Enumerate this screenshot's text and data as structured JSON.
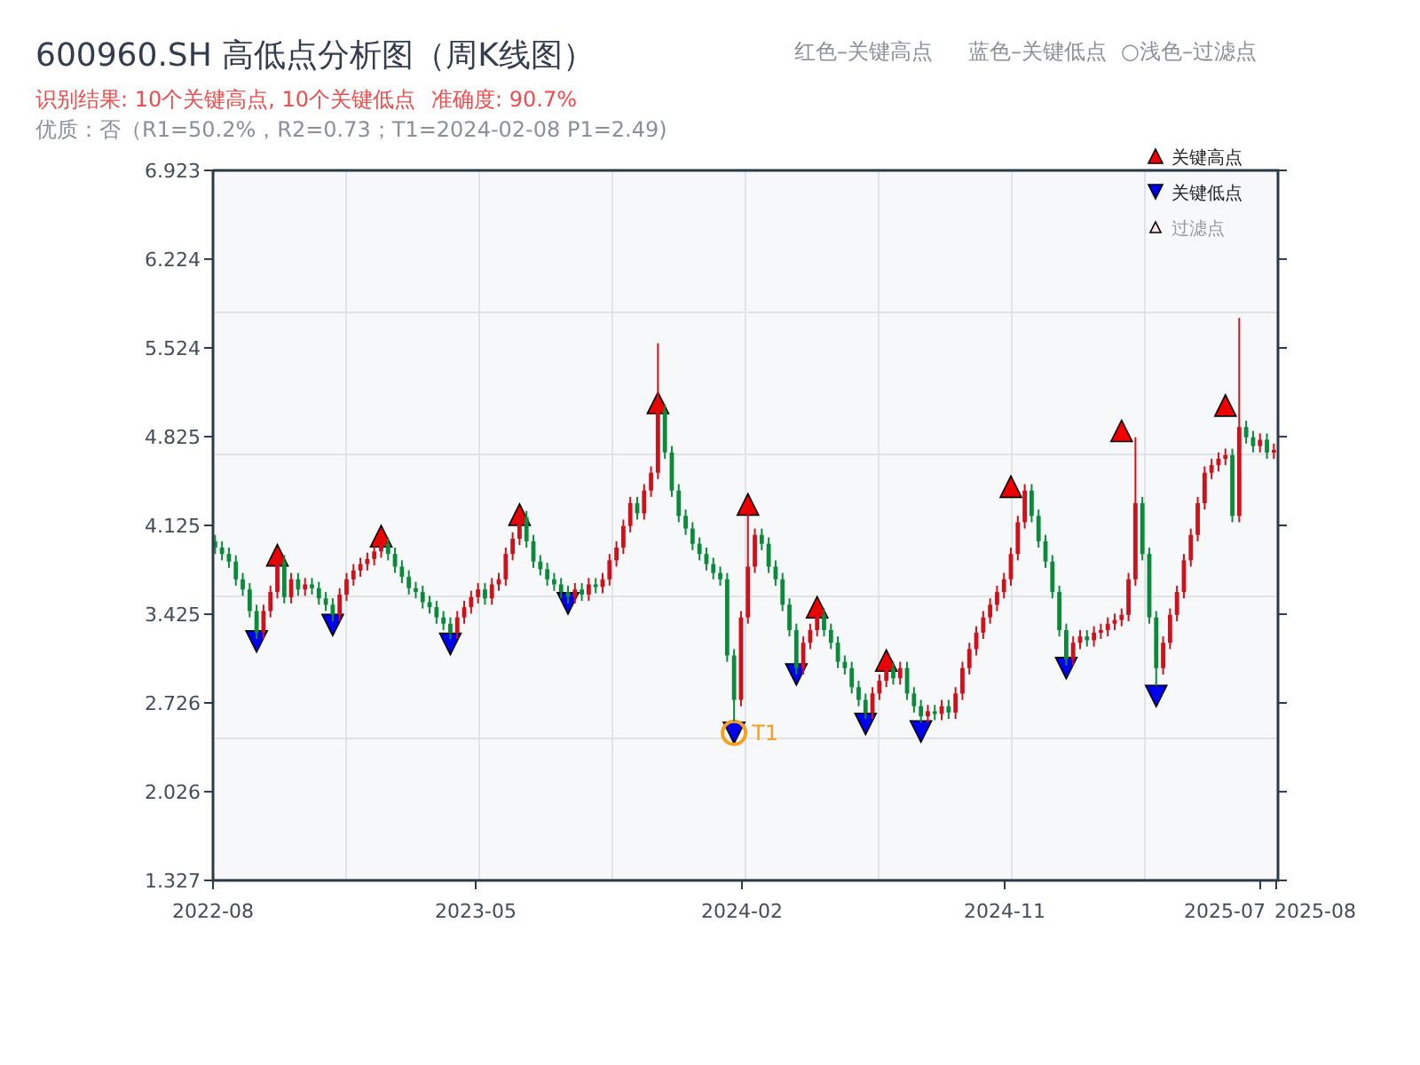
{
  "title": "600960.SH 高低点分析图（周K线图）",
  "top_legend": [
    {
      "kind": "high",
      "label": "红色–关键高点"
    },
    {
      "kind": "low",
      "label": "蓝色–关键低点"
    },
    {
      "kind": "filtered",
      "label": "○浅色–过滤点"
    }
  ],
  "result": {
    "summary": "识别结果: 10个关键高点, 10个关键低点",
    "accuracy": "准确度: 90.7%"
  },
  "quality": "优质：否（R1=50.2%，R2=0.73；T1=2024-02-08 P1=2.49)",
  "chart": {
    "legend": [
      {
        "kind": "high",
        "label": "关键高点"
      },
      {
        "kind": "low",
        "label": "关键低点"
      },
      {
        "kind": "filtered",
        "label": "过滤点"
      }
    ],
    "x_labels": [
      "2022-08",
      "2023-05",
      "2024-02",
      "2024-11",
      "2025-07",
      "2025-08"
    ],
    "chart_data": {
      "type": "candlestick",
      "ylim": [
        1.327,
        6.923
      ],
      "yticks": [
        {
          "value": 6.923,
          "label": "6.923"
        },
        {
          "value": 6.224,
          "label": "6.224"
        },
        {
          "value": 5.524,
          "label": "5.524"
        },
        {
          "value": 4.825,
          "label": "4.825"
        },
        {
          "value": 4.125,
          "label": "4.125"
        },
        {
          "value": 3.425,
          "label": "3.425"
        },
        {
          "value": 2.726,
          "label": "2.726"
        },
        {
          "value": 2.026,
          "label": "2.026"
        },
        {
          "value": 1.327,
          "label": "1.327"
        }
      ],
      "series": [
        {
          "type": "scatter",
          "color": "#f00000",
          "marker": "triangle-up",
          "values": [
            null,
            null,
            null,
            null,
            null,
            null,
            null,
            null,
            null,
            3.89,
            null,
            null,
            null,
            null,
            null,
            null,
            null,
            null,
            null,
            null,
            null,
            null,
            null,
            null,
            4.04,
            null,
            null,
            null,
            null,
            null,
            null,
            null,
            null,
            null,
            null,
            null,
            null,
            null,
            null,
            null,
            null,
            null,
            null,
            null,
            4.21,
            null,
            null,
            null,
            null,
            null,
            null,
            null,
            null,
            null,
            null,
            null,
            null,
            null,
            null,
            null,
            null,
            null,
            null,
            null,
            5.09,
            null,
            null,
            null,
            null,
            null,
            null,
            null,
            null,
            null,
            null,
            null,
            null,
            4.29,
            null,
            null,
            null,
            null,
            null,
            null,
            null,
            null,
            null,
            3.48,
            null,
            null,
            null,
            null,
            null,
            null,
            null,
            null,
            null,
            3.06,
            null,
            null,
            null,
            null,
            null,
            null,
            null,
            null,
            null,
            null,
            null,
            null,
            null,
            null,
            null,
            null,
            null,
            4.43,
            null,
            null,
            null,
            null,
            null,
            null,
            null,
            null,
            null,
            null,
            null,
            null,
            null,
            null,
            null,
            4.87,
            null,
            null,
            null,
            null,
            null,
            null,
            null,
            null,
            null,
            null,
            null,
            null,
            null,
            null,
            5.07,
            null,
            null,
            null,
            null,
            null
          ]
        },
        {
          "type": "scatter",
          "color": "#0000f0",
          "marker": "triangle-down",
          "values": [
            null,
            null,
            null,
            null,
            null,
            null,
            3.21,
            null,
            null,
            null,
            null,
            null,
            null,
            null,
            null,
            null,
            null,
            3.34,
            null,
            null,
            null,
            null,
            null,
            null,
            null,
            null,
            null,
            null,
            null,
            null,
            null,
            null,
            null,
            null,
            3.19,
            null,
            null,
            null,
            null,
            null,
            null,
            null,
            null,
            null,
            null,
            null,
            null,
            null,
            null,
            null,
            null,
            3.51,
            null,
            null,
            null,
            null,
            null,
            null,
            null,
            null,
            null,
            null,
            null,
            null,
            null,
            null,
            null,
            null,
            null,
            null,
            null,
            null,
            null,
            null,
            null,
            2.49,
            null,
            null,
            null,
            null,
            null,
            null,
            null,
            null,
            2.95,
            null,
            null,
            null,
            null,
            null,
            null,
            null,
            null,
            null,
            2.56,
            null,
            null,
            null,
            null,
            null,
            null,
            null,
            2.5,
            null,
            null,
            null,
            null,
            null,
            null,
            null,
            null,
            null,
            null,
            null,
            null,
            null,
            null,
            null,
            null,
            null,
            null,
            null,
            null,
            3.0,
            null,
            null,
            null,
            null,
            null,
            null,
            null,
            null,
            null,
            null,
            null,
            null,
            2.78,
            null,
            null,
            null,
            null,
            null,
            null,
            null,
            null,
            null,
            null,
            null,
            null,
            null,
            null,
            null,
            null,
            null
          ]
        }
      ],
      "annotations": [
        {
          "text": "T1"
        }
      ],
      "ohlc": [
        [
          4.0,
          4.05,
          3.9,
          3.95
        ],
        [
          3.95,
          4.0,
          3.85,
          3.9
        ],
        [
          3.9,
          3.95,
          3.79,
          3.84
        ],
        [
          3.84,
          3.89,
          3.65,
          3.7
        ],
        [
          3.7,
          3.75,
          3.57,
          3.62
        ],
        [
          3.62,
          3.67,
          3.4,
          3.45
        ],
        [
          3.45,
          3.5,
          3.23,
          3.28
        ],
        [
          3.28,
          3.5,
          3.23,
          3.45
        ],
        [
          3.45,
          3.65,
          3.4,
          3.6
        ],
        [
          3.6,
          3.89,
          3.55,
          3.84
        ],
        [
          3.84,
          3.89,
          3.51,
          3.56
        ],
        [
          3.56,
          3.75,
          3.51,
          3.7
        ],
        [
          3.7,
          3.75,
          3.57,
          3.62
        ],
        [
          3.62,
          3.71,
          3.57,
          3.66
        ],
        [
          3.66,
          3.71,
          3.58,
          3.63
        ],
        [
          3.63,
          3.68,
          3.5,
          3.55
        ],
        [
          3.55,
          3.6,
          3.45,
          3.5
        ],
        [
          3.5,
          3.55,
          3.37,
          3.42
        ],
        [
          3.42,
          3.63,
          3.37,
          3.58
        ],
        [
          3.58,
          3.75,
          3.53,
          3.7
        ],
        [
          3.7,
          3.82,
          3.65,
          3.77
        ],
        [
          3.77,
          3.87,
          3.72,
          3.82
        ],
        [
          3.82,
          3.91,
          3.77,
          3.86
        ],
        [
          3.86,
          3.97,
          3.81,
          3.92
        ],
        [
          3.92,
          4.03,
          3.87,
          3.98
        ],
        [
          3.98,
          4.03,
          3.85,
          3.9
        ],
        [
          3.9,
          3.95,
          3.75,
          3.8
        ],
        [
          3.8,
          3.85,
          3.67,
          3.72
        ],
        [
          3.72,
          3.77,
          3.58,
          3.63
        ],
        [
          3.63,
          3.68,
          3.55,
          3.6
        ],
        [
          3.6,
          3.65,
          3.47,
          3.52
        ],
        [
          3.52,
          3.57,
          3.43,
          3.48
        ],
        [
          3.48,
          3.53,
          3.35,
          3.4
        ],
        [
          3.4,
          3.45,
          3.3,
          3.35
        ],
        [
          3.35,
          3.4,
          3.23,
          3.28
        ],
        [
          3.28,
          3.45,
          3.23,
          3.4
        ],
        [
          3.4,
          3.53,
          3.35,
          3.48
        ],
        [
          3.48,
          3.61,
          3.43,
          3.56
        ],
        [
          3.56,
          3.67,
          3.51,
          3.62
        ],
        [
          3.62,
          3.67,
          3.5,
          3.55
        ],
        [
          3.55,
          3.71,
          3.5,
          3.66
        ],
        [
          3.66,
          3.75,
          3.61,
          3.7
        ],
        [
          3.7,
          3.95,
          3.65,
          3.9
        ],
        [
          3.9,
          4.07,
          3.85,
          4.02
        ],
        [
          4.02,
          4.24,
          3.97,
          4.19
        ],
        [
          4.19,
          4.24,
          3.95,
          4.0
        ],
        [
          4.0,
          4.05,
          3.79,
          3.84
        ],
        [
          3.84,
          3.89,
          3.73,
          3.78
        ],
        [
          3.78,
          3.83,
          3.65,
          3.7
        ],
        [
          3.7,
          3.75,
          3.61,
          3.66
        ],
        [
          3.66,
          3.71,
          3.55,
          3.6
        ],
        [
          3.6,
          3.65,
          3.51,
          3.56
        ],
        [
          3.56,
          3.67,
          3.51,
          3.62
        ],
        [
          3.62,
          3.67,
          3.53,
          3.58
        ],
        [
          3.58,
          3.71,
          3.53,
          3.66
        ],
        [
          3.66,
          3.71,
          3.59,
          3.64
        ],
        [
          3.64,
          3.75,
          3.59,
          3.7
        ],
        [
          3.7,
          3.9,
          3.65,
          3.85
        ],
        [
          3.85,
          4.0,
          3.8,
          3.95
        ],
        [
          3.95,
          4.17,
          3.9,
          4.12
        ],
        [
          4.12,
          4.35,
          4.07,
          4.3
        ],
        [
          4.3,
          4.35,
          4.17,
          4.22
        ],
        [
          4.22,
          4.45,
          4.17,
          4.4
        ],
        [
          4.4,
          4.59,
          4.35,
          4.54
        ],
        [
          4.54,
          5.56,
          4.49,
          5.03
        ],
        [
          5.03,
          5.08,
          4.65,
          4.7
        ],
        [
          4.7,
          4.75,
          4.35,
          4.4
        ],
        [
          4.4,
          4.45,
          4.15,
          4.2
        ],
        [
          4.2,
          4.25,
          4.05,
          4.1
        ],
        [
          4.1,
          4.15,
          3.93,
          3.98
        ],
        [
          3.98,
          4.03,
          3.85,
          3.9
        ],
        [
          3.9,
          3.95,
          3.77,
          3.82
        ],
        [
          3.82,
          3.87,
          3.7,
          3.75
        ],
        [
          3.75,
          3.8,
          3.65,
          3.7
        ],
        [
          3.7,
          3.75,
          3.05,
          3.1
        ],
        [
          3.1,
          3.15,
          2.58,
          2.75
        ],
        [
          2.75,
          3.45,
          2.7,
          3.4
        ],
        [
          3.4,
          4.26,
          3.35,
          3.8
        ],
        [
          3.8,
          4.1,
          3.75,
          4.05
        ],
        [
          4.05,
          4.1,
          3.93,
          3.98
        ],
        [
          3.98,
          4.03,
          3.75,
          3.8
        ],
        [
          3.8,
          3.85,
          3.65,
          3.7
        ],
        [
          3.7,
          3.75,
          3.45,
          3.5
        ],
        [
          3.5,
          3.55,
          3.25,
          3.3
        ],
        [
          3.3,
          3.35,
          2.95,
          3.0
        ],
        [
          3.0,
          3.25,
          2.95,
          3.2
        ],
        [
          3.2,
          3.35,
          3.15,
          3.3
        ],
        [
          3.3,
          3.47,
          3.25,
          3.42
        ],
        [
          3.42,
          3.47,
          3.25,
          3.3
        ],
        [
          3.3,
          3.35,
          3.15,
          3.2
        ],
        [
          3.2,
          3.25,
          3.0,
          3.05
        ],
        [
          3.05,
          3.1,
          2.95,
          3.0
        ],
        [
          3.0,
          3.05,
          2.8,
          2.85
        ],
        [
          2.85,
          2.9,
          2.7,
          2.75
        ],
        [
          2.75,
          2.8,
          2.6,
          2.65
        ],
        [
          2.65,
          2.85,
          2.6,
          2.8
        ],
        [
          2.8,
          2.95,
          2.75,
          2.9
        ],
        [
          2.9,
          3.05,
          2.85,
          3.0
        ],
        [
          3.0,
          3.05,
          2.87,
          2.92
        ],
        [
          2.92,
          3.05,
          2.87,
          3.0
        ],
        [
          3.0,
          3.05,
          2.75,
          2.8
        ],
        [
          2.8,
          2.85,
          2.65,
          2.7
        ],
        [
          2.7,
          2.75,
          2.57,
          2.62
        ],
        [
          2.62,
          2.71,
          2.57,
          2.66
        ],
        [
          2.66,
          2.71,
          2.59,
          2.64
        ],
        [
          2.64,
          2.75,
          2.59,
          2.7
        ],
        [
          2.7,
          2.75,
          2.6,
          2.65
        ],
        [
          2.65,
          2.85,
          2.6,
          2.8
        ],
        [
          2.8,
          3.05,
          2.75,
          3.0
        ],
        [
          3.0,
          3.2,
          2.95,
          3.15
        ],
        [
          3.15,
          3.33,
          3.1,
          3.28
        ],
        [
          3.28,
          3.45,
          3.23,
          3.4
        ],
        [
          3.4,
          3.55,
          3.35,
          3.5
        ],
        [
          3.5,
          3.65,
          3.45,
          3.6
        ],
        [
          3.6,
          3.75,
          3.55,
          3.7
        ],
        [
          3.7,
          3.95,
          3.65,
          3.9
        ],
        [
          3.9,
          4.2,
          3.85,
          4.15
        ],
        [
          4.15,
          4.45,
          4.1,
          4.4
        ],
        [
          4.4,
          4.45,
          4.15,
          4.2
        ],
        [
          4.2,
          4.25,
          3.95,
          4.0
        ],
        [
          4.0,
          4.05,
          3.79,
          3.84
        ],
        [
          3.84,
          3.89,
          3.55,
          3.6
        ],
        [
          3.6,
          3.65,
          3.25,
          3.3
        ],
        [
          3.3,
          3.35,
          3.02,
          3.07
        ],
        [
          3.07,
          3.25,
          3.02,
          3.2
        ],
        [
          3.2,
          3.3,
          3.15,
          3.25
        ],
        [
          3.25,
          3.3,
          3.17,
          3.22
        ],
        [
          3.22,
          3.33,
          3.17,
          3.28
        ],
        [
          3.28,
          3.35,
          3.23,
          3.3
        ],
        [
          3.3,
          3.4,
          3.25,
          3.35
        ],
        [
          3.35,
          3.43,
          3.3,
          3.38
        ],
        [
          3.38,
          3.47,
          3.33,
          3.42
        ],
        [
          3.42,
          3.75,
          3.37,
          3.7
        ],
        [
          3.7,
          4.82,
          3.65,
          4.3
        ],
        [
          4.3,
          4.35,
          3.85,
          3.9
        ],
        [
          3.9,
          3.95,
          3.35,
          3.4
        ],
        [
          3.4,
          3.45,
          2.86,
          3.0
        ],
        [
          3.0,
          3.25,
          2.95,
          3.2
        ],
        [
          3.2,
          3.47,
          3.15,
          3.42
        ],
        [
          3.42,
          3.65,
          3.37,
          3.6
        ],
        [
          3.6,
          3.9,
          3.55,
          3.85
        ],
        [
          3.85,
          4.1,
          3.8,
          4.05
        ],
        [
          4.05,
          4.35,
          4.0,
          4.3
        ],
        [
          4.3,
          4.59,
          4.25,
          4.54
        ],
        [
          4.54,
          4.65,
          4.49,
          4.6
        ],
        [
          4.6,
          4.7,
          4.55,
          4.65
        ],
        [
          4.65,
          4.73,
          4.6,
          4.68
        ],
        [
          4.68,
          4.73,
          4.15,
          4.2
        ],
        [
          4.2,
          5.76,
          4.15,
          4.9
        ],
        [
          4.9,
          4.95,
          4.77,
          4.82
        ],
        [
          4.82,
          4.87,
          4.7,
          4.75
        ],
        [
          4.75,
          4.85,
          4.7,
          4.8
        ],
        [
          4.8,
          4.85,
          4.65,
          4.7
        ],
        [
          4.7,
          4.77,
          4.65,
          4.72
        ]
      ]
    }
  }
}
